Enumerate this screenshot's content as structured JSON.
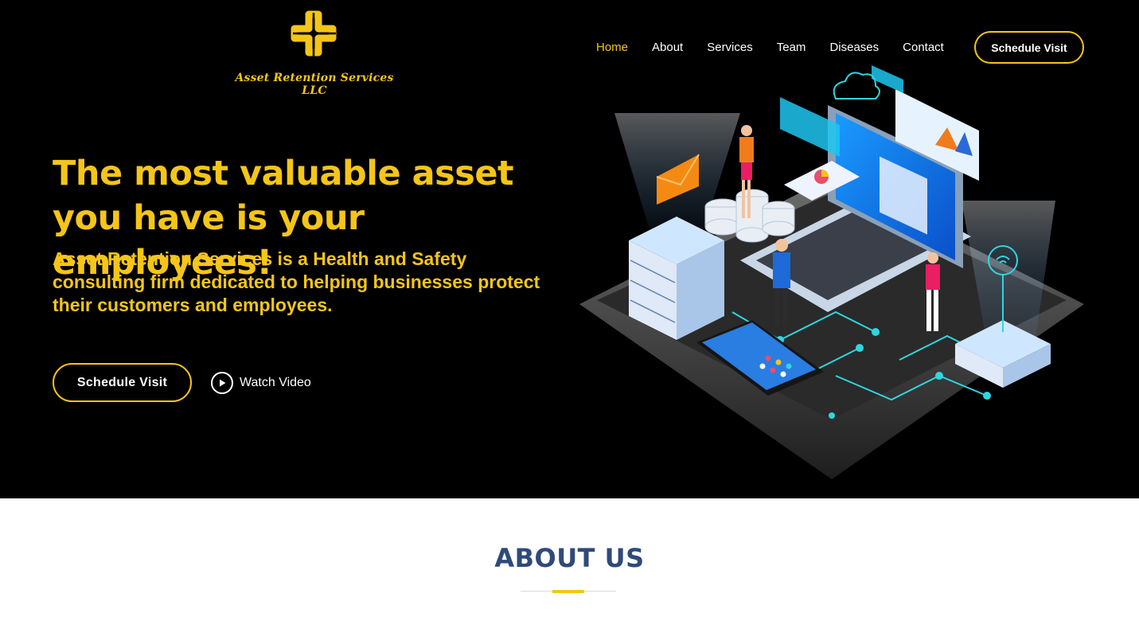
{
  "brand": {
    "name": "Asset Retention Services LLC",
    "accent_color": "#f5c518",
    "logo_icon": "cross-knot-icon"
  },
  "nav": {
    "items": [
      {
        "label": "Home",
        "active": true
      },
      {
        "label": "About",
        "active": false
      },
      {
        "label": "Services",
        "active": false
      },
      {
        "label": "Team",
        "active": false
      },
      {
        "label": "Diseases",
        "active": false
      },
      {
        "label": "Contact",
        "active": false
      }
    ],
    "cta_label": "Schedule Visit"
  },
  "hero": {
    "headline": "The most valuable asset you have is your employees!",
    "subheadline": "Asset Retention Services is a Health and Safety consulting firm dedicated to helping businesses protect their customers and employees.",
    "cta_label": "Schedule Visit",
    "video_label": "Watch Video",
    "video_icon": "play-icon",
    "illustration": "isometric-tech-workspace-illustration"
  },
  "about": {
    "title": "ABOUT US",
    "title_color": "#2f4a7a"
  }
}
